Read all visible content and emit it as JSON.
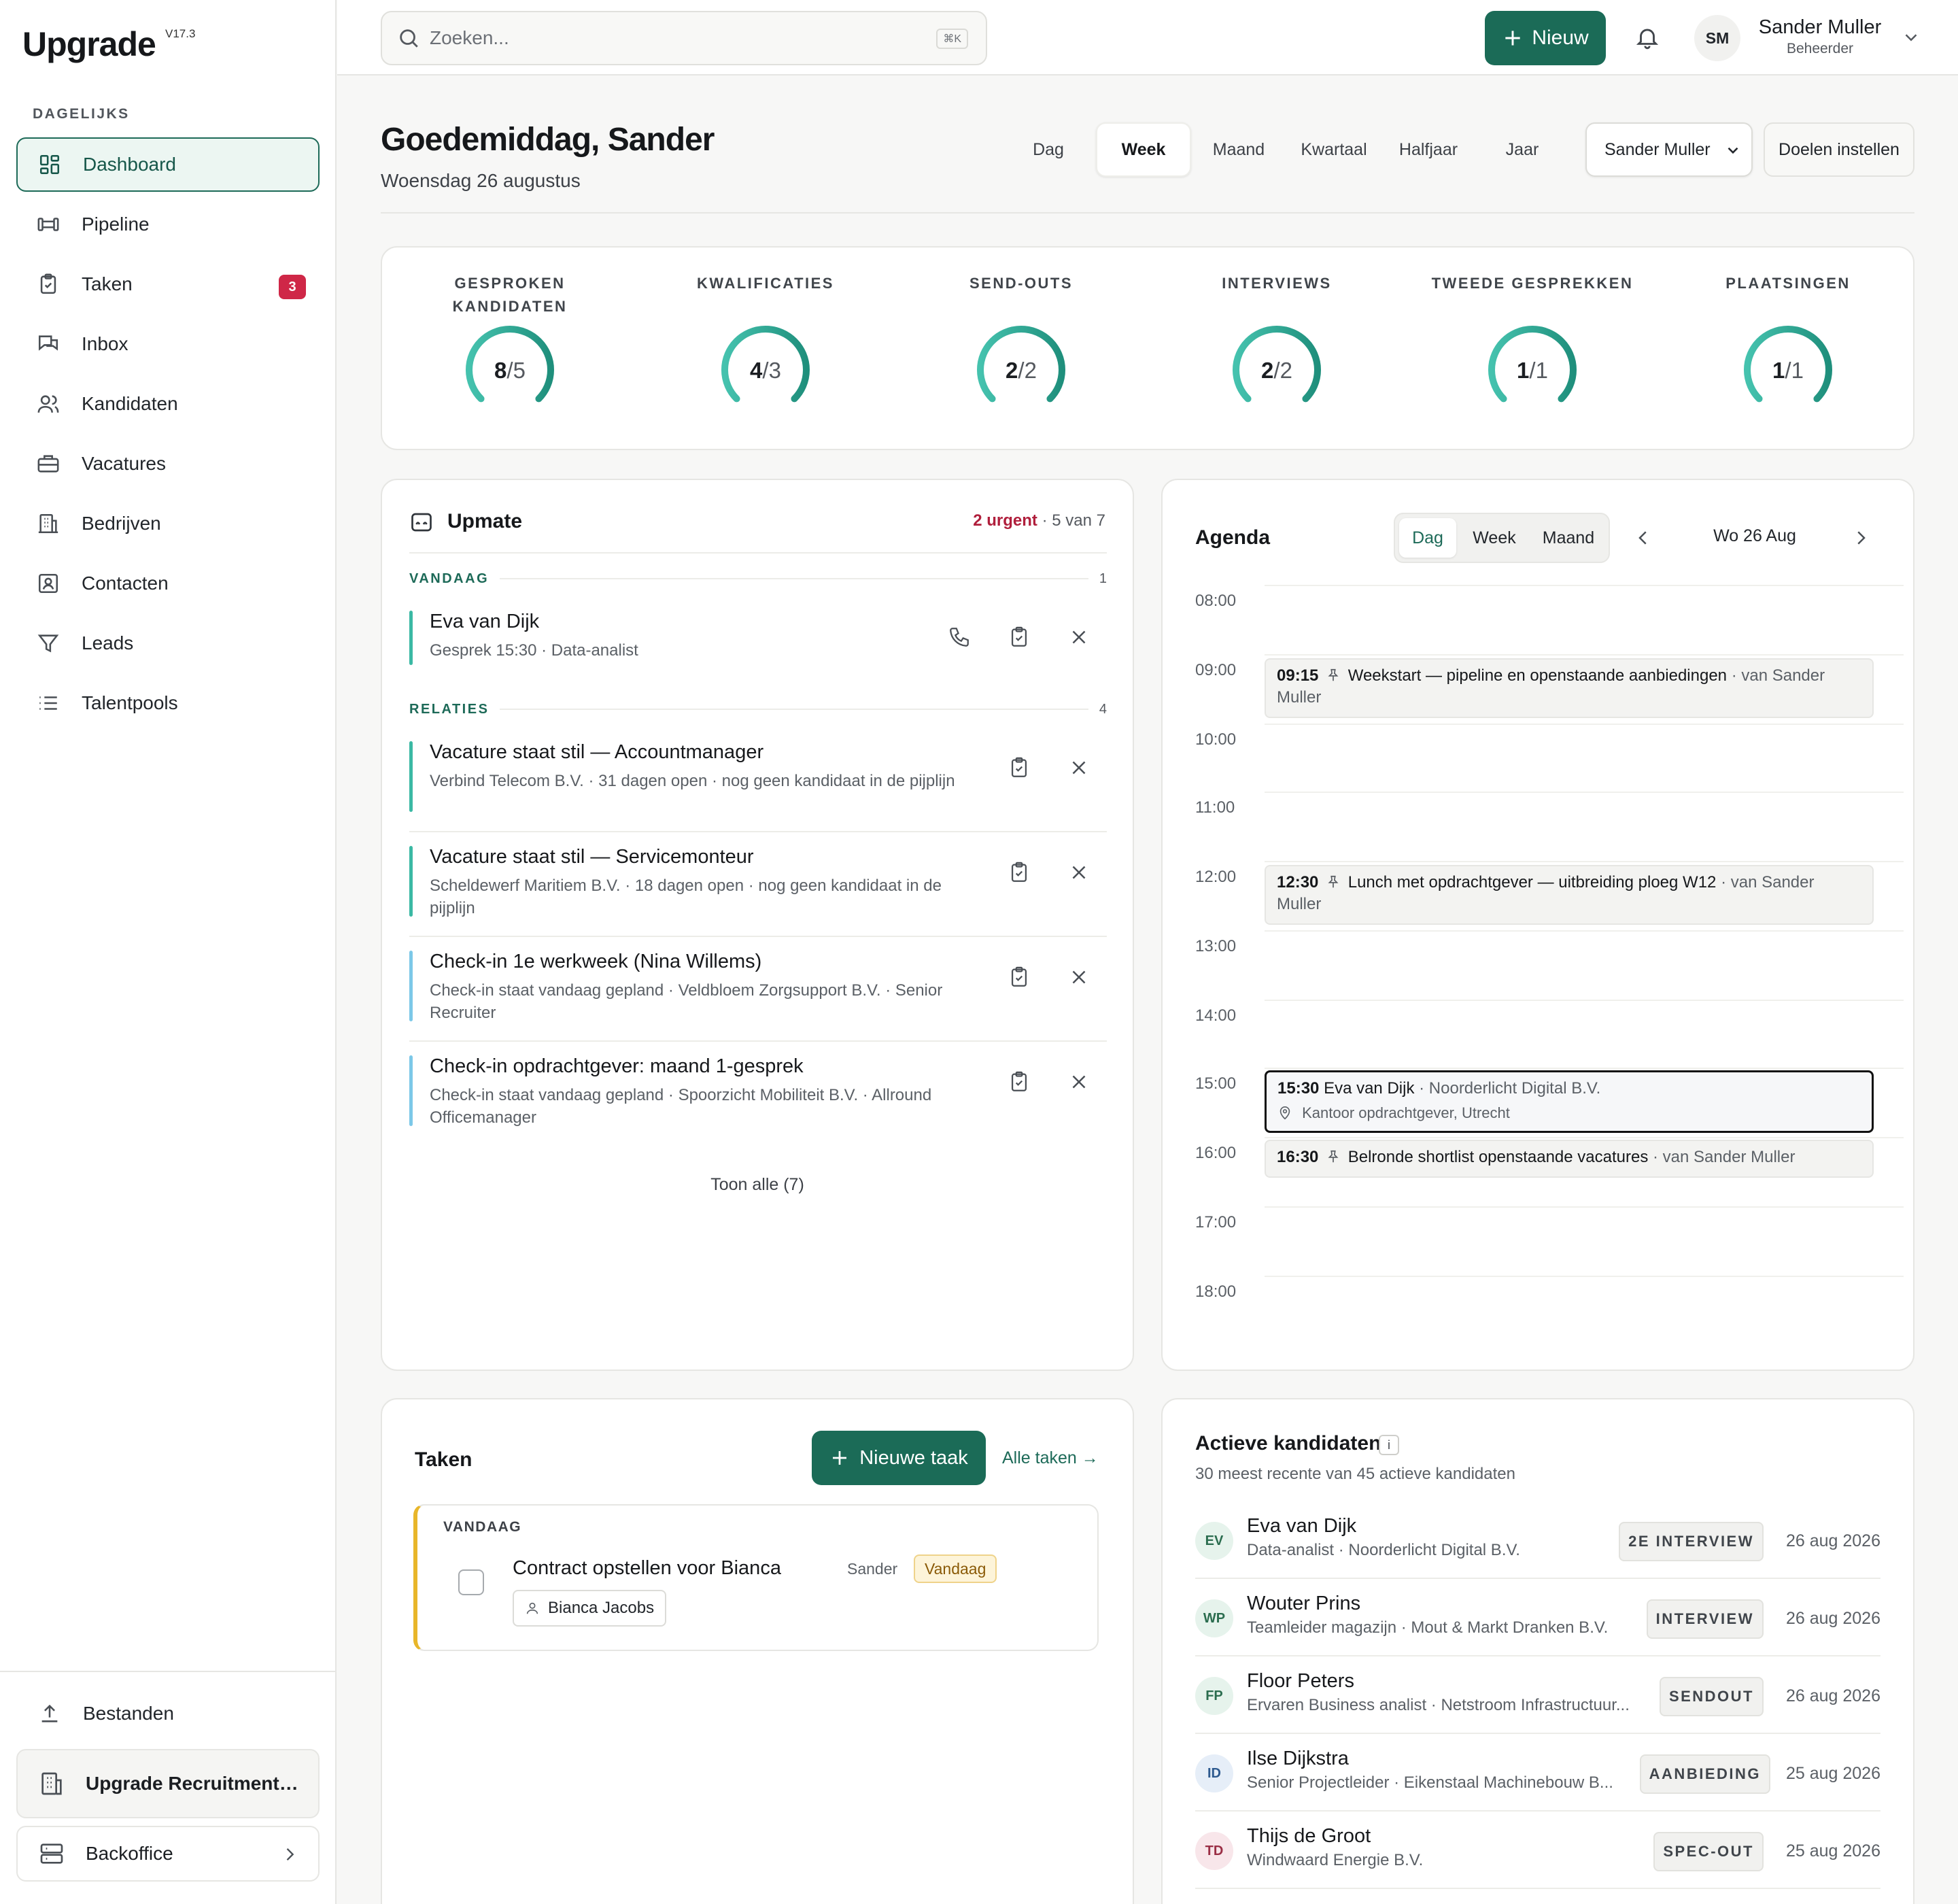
{
  "app": {
    "name": "Upgrade",
    "version": "V17.3"
  },
  "sidebar": {
    "section": "DAGELIJKS",
    "items": [
      {
        "label": "Dashboard",
        "icon": "dashboard-icon",
        "active": true
      },
      {
        "label": "Pipeline",
        "icon": "pipeline-icon"
      },
      {
        "label": "Taken",
        "icon": "clipboard-icon",
        "badge": "3"
      },
      {
        "label": "Inbox",
        "icon": "chat-icon"
      },
      {
        "label": "Kandidaten",
        "icon": "people-icon"
      },
      {
        "label": "Vacatures",
        "icon": "briefcase-icon"
      },
      {
        "label": "Bedrijven",
        "icon": "building-icon"
      },
      {
        "label": "Contacten",
        "icon": "contact-card-icon"
      },
      {
        "label": "Leads",
        "icon": "filter-icon"
      },
      {
        "label": "Talentpools",
        "icon": "list-icon"
      }
    ],
    "files": "Bestanden",
    "org": "Upgrade Recruitment B.V.",
    "backoffice": "Backoffice"
  },
  "topbar": {
    "search_placeholder": "Zoeken...",
    "search_shortcut": "⌘K",
    "new_label": "Nieuw",
    "user_initials": "SM",
    "user_name": "Sander Muller",
    "user_role": "Beheerder"
  },
  "header": {
    "greeting": "Goedemiddag, Sander",
    "date": "Woensdag 26 augustus",
    "periods": [
      "Dag",
      "Week",
      "Maand",
      "Kwartaal",
      "Halfjaar",
      "Jaar"
    ],
    "active_period": "Week",
    "user_filter": "Sander Muller",
    "goals_button": "Doelen instellen"
  },
  "kpis": [
    {
      "label": "GESPROKEN KANDIDATEN",
      "value": 8,
      "target": 5
    },
    {
      "label": "KWALIFICATIES",
      "value": 4,
      "target": 3
    },
    {
      "label": "SEND-OUTS",
      "value": 2,
      "target": 2
    },
    {
      "label": "INTERVIEWS",
      "value": 2,
      "target": 2
    },
    {
      "label": "TWEEDE GESPREKKEN",
      "value": 1,
      "target": 1
    },
    {
      "label": "PLAATSINGEN",
      "value": 1,
      "target": 1
    }
  ],
  "upmate": {
    "title": "Upmate",
    "urgent": "2 urgent",
    "count": "· 5 van 7",
    "groups": [
      {
        "label": "VANDAAG",
        "count": "1"
      },
      {
        "label": "RELATIES",
        "count": "4"
      }
    ],
    "items": [
      {
        "title": "Eva van Dijk",
        "detail": "Gesprek 15:30 · Data-analist",
        "color": "#3bb9a4"
      },
      {
        "title": "Vacature staat stil — Accountmanager",
        "detail": "Verbind Telecom B.V. · 31 dagen open · nog geen kandidaat in de pijplijn",
        "color": "#3bb9a4"
      },
      {
        "title": "Vacature staat stil — Servicemonteur",
        "detail": "Scheldewerf Maritiem B.V. · 18 dagen open · nog geen kandidaat in de pijplijn",
        "color": "#3bb9a4"
      },
      {
        "title": "Check-in 1e werkweek (Nina Willems)",
        "detail": "Check-in staat vandaag gepland · Veldbloem Zorgsupport B.V. · Senior Recruiter",
        "color": "#7cc8e8"
      },
      {
        "title": "Check-in opdrachtgever: maand 1-gesprek",
        "detail": "Check-in staat vandaag gepland · Spoorzicht Mobiliteit B.V. · Allround Officemanager",
        "color": "#7cc8e8"
      }
    ],
    "show_all": "Toon alle (7)"
  },
  "agenda": {
    "title": "Agenda",
    "views": [
      "Dag",
      "Week",
      "Maand"
    ],
    "active_view": "Dag",
    "date": "Wo 26 Aug",
    "hours": [
      "08:00",
      "09:00",
      "10:00",
      "11:00",
      "12:00",
      "13:00",
      "14:00",
      "15:00",
      "16:00",
      "17:00",
      "18:00"
    ],
    "events": [
      {
        "time": "09:15",
        "title": "Weekstart — pipeline en openstaande aanbiedingen",
        "by": "· van Sander Muller",
        "pinned": true
      },
      {
        "time": "12:30",
        "title": "Lunch met opdrachtgever — uitbreiding ploeg W12",
        "by": "· van Sander Muller",
        "pinned": true
      },
      {
        "time": "15:30",
        "title": "Eva van Dijk",
        "by": "· Noorderlicht Digital B.V.",
        "location": "Kantoor opdrachtgever, Utrecht",
        "pinned": false
      },
      {
        "time": "16:30",
        "title": "Belronde shortlist openstaande vacatures",
        "by": "· van Sander Muller",
        "pinned": true
      }
    ]
  },
  "taken": {
    "title": "Taken",
    "new_label": "Nieuwe taak",
    "all_link": "Alle taken →",
    "group": "VANDAAG",
    "task": {
      "name": "Contract opstellen voor Bianca",
      "owner": "Sander",
      "badge": "Vandaag",
      "person": "Bianca Jacobs"
    }
  },
  "kandidaten": {
    "title": "Actieve kandidaten",
    "info": "i",
    "subtitle": "30 meest recente van 45 actieve kandidaten",
    "rows": [
      {
        "initials": "EV",
        "name": "Eva van Dijk",
        "detail": "Data-analist · Noorderlicht Digital B.V.",
        "stage": "2E INTERVIEW",
        "date": "26 aug 2026",
        "bg": "#e6f3ec",
        "fg": "#2b6d4f"
      },
      {
        "initials": "WP",
        "name": "Wouter Prins",
        "detail": "Teamleider magazijn · Mout & Markt Dranken B.V.",
        "stage": "INTERVIEW",
        "date": "26 aug 2026",
        "bg": "#e6f3ec",
        "fg": "#2b6d4f"
      },
      {
        "initials": "FP",
        "name": "Floor Peters",
        "detail": "Ervaren Business analist · Netstroom Infrastructuur...",
        "stage": "SENDOUT",
        "date": "26 aug 2026",
        "bg": "#e6f3ec",
        "fg": "#2b6d4f"
      },
      {
        "initials": "ID",
        "name": "Ilse Dijkstra",
        "detail": "Senior Projectleider · Eikenstaal Machinebouw B...",
        "stage": "AANBIEDING",
        "date": "25 aug 2026",
        "bg": "#e6eef8",
        "fg": "#2e5a8f"
      },
      {
        "initials": "TD",
        "name": "Thijs de Groot",
        "detail": "Windwaard Energie B.V.",
        "stage": "SPEC-OUT",
        "date": "25 aug 2026",
        "bg": "#f8e6ea",
        "fg": "#9a2e45"
      }
    ]
  }
}
